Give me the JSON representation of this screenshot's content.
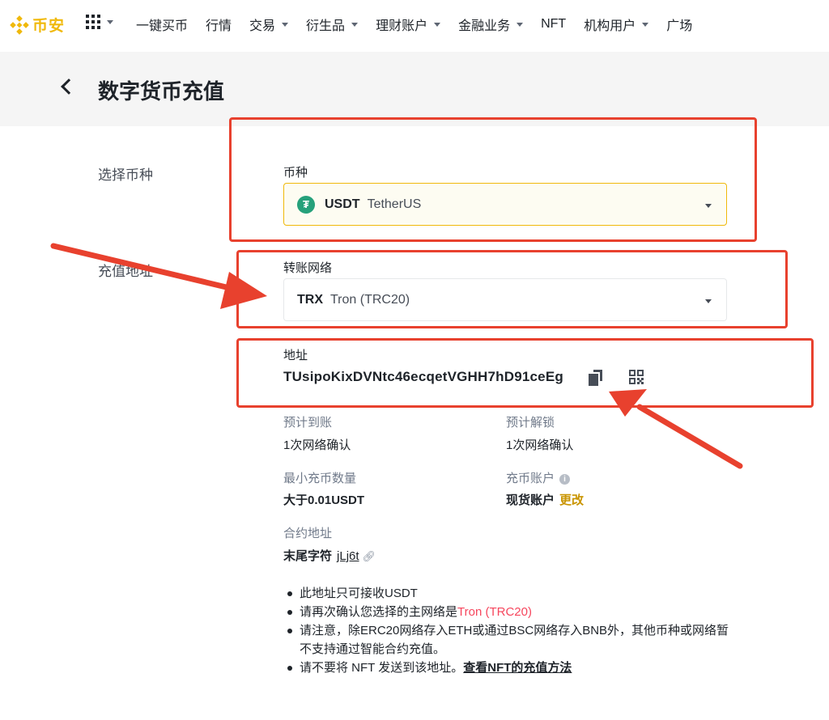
{
  "nav": {
    "logo_text": "币安",
    "items": [
      {
        "label": "一键买币",
        "caret": false
      },
      {
        "label": "行情",
        "caret": false
      },
      {
        "label": "交易",
        "caret": true
      },
      {
        "label": "衍生品",
        "caret": true
      },
      {
        "label": "理财账户",
        "caret": true
      },
      {
        "label": "金融业务",
        "caret": true
      },
      {
        "label": "NFT",
        "caret": false
      },
      {
        "label": "机构用户",
        "caret": true
      },
      {
        "label": "广场",
        "caret": false
      }
    ]
  },
  "page": {
    "title": "数字货币充值"
  },
  "side": {
    "select_coin": "选择币种",
    "deposit_address": "充值地址"
  },
  "coin": {
    "label": "币种",
    "symbol": "USDT",
    "name": "TetherUS",
    "icon": "tether-icon"
  },
  "network": {
    "label": "转账网络",
    "symbol": "TRX",
    "name": "Tron (TRC20)"
  },
  "address": {
    "label": "地址",
    "value": "TUsipoKixDVNtc46ecqetVGHH7hD91ceEg"
  },
  "details": {
    "expected_arrival_label": "预计到账",
    "expected_arrival_value": "1次网络确认",
    "expected_unlock_label": "预计解锁",
    "expected_unlock_value": "1次网络确认",
    "min_deposit_label": "最小充币数量",
    "min_deposit_value": "大于0.01USDT",
    "deposit_account_label": "充币账户",
    "deposit_account_value": "现货账户",
    "change_label": "更改",
    "contract_label": "合约地址",
    "contract_prefix": "末尾字符",
    "contract_suffix": "jLj6t"
  },
  "notes": {
    "n1": "此地址只可接收USDT",
    "n2_prefix": "请再次确认您选择的主网络是",
    "n2_highlight": "Tron (TRC20)",
    "n3": "请注意，除ERC20网络存入ETH或通过BSC网络存入BNB外，其他币种或网络暂不支持通过智能合约充值。",
    "n4_prefix": "请不要将 NFT 发送到该地址。",
    "n4_link": "查看NFT的充值方法"
  },
  "colors": {
    "brand": "#f0b90b",
    "annotation": "#e8412e",
    "tether": "#26a17b",
    "highlight_text": "#f6465d"
  }
}
